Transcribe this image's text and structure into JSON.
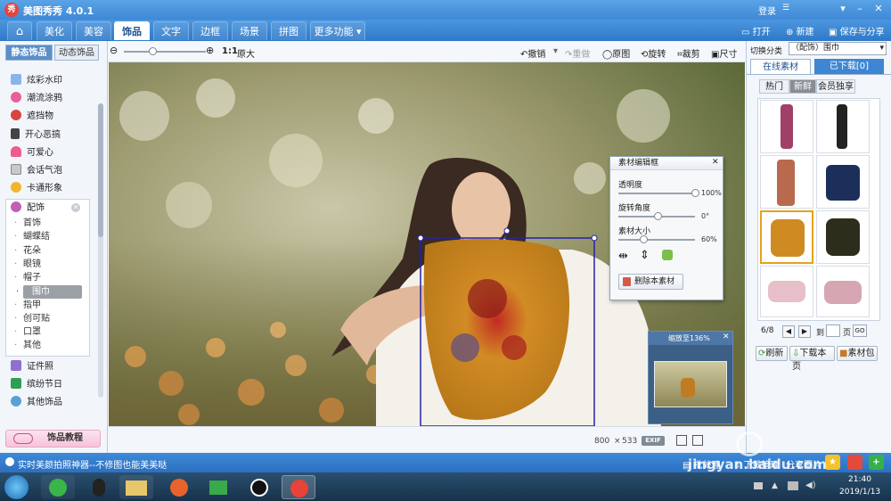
{
  "app": {
    "title": "美图秀秀 4.0.1",
    "logo_text": "秀",
    "login": "登录"
  },
  "nav": {
    "tabs": [
      "美化",
      "美容",
      "饰品",
      "文字",
      "边框",
      "场景",
      "拼图"
    ],
    "more": "更多功能",
    "open": "打开",
    "new": "新建",
    "save_share": "保存与分享"
  },
  "left": {
    "tab_static": "静态饰品",
    "tab_dynamic": "动态饰品",
    "categories": [
      "炫彩水印",
      "潮流涂鸦",
      "遮挡物",
      "开心恶搞",
      "可爱心",
      "会话气泡",
      "卡通形象"
    ],
    "expanded": {
      "label": "配饰",
      "subs": [
        "首饰",
        "蝴蝶结",
        "花朵",
        "眼镜",
        "帽子",
        "围巾",
        "指甲",
        "创可贴",
        "口罩",
        "其他"
      ],
      "selected": "围巾"
    },
    "categories_bottom": [
      "证件照",
      "缤纷节日",
      "其他饰品"
    ],
    "tutorial": "饰品教程"
  },
  "toolbar": {
    "zoom_ratio": "1:1",
    "original_size": "原大",
    "undo": "撤销",
    "redo": "重做",
    "original": "原图",
    "rotate": "旋转",
    "crop": "裁剪",
    "resize": "尺寸"
  },
  "right": {
    "category_label": "切换分类",
    "category_value": "（配饰）围巾",
    "tab_online": "在线素材",
    "tab_downloaded": "已下载[0]",
    "filters": [
      "热门",
      "新鲜",
      "会员独享"
    ],
    "active_filter": "新鲜",
    "page_current": "6/8",
    "goto_label": "到",
    "page_unit": "页",
    "go": "GO",
    "refresh": "刷新",
    "download_page": "下载本页",
    "material_pack": "素材包"
  },
  "dialog": {
    "title": "素材编辑框",
    "opacity_label": "透明度",
    "opacity_value": "100%",
    "opacity_level": 1.0,
    "rotate_label": "旋转角度",
    "rotate_value": "0°",
    "rotate_level": 0.5,
    "size_label": "素材大小",
    "size_value": "60%",
    "size_level": 0.3,
    "delete": "删除本素材"
  },
  "minimap": {
    "zoom_text": "缩放至136%"
  },
  "status": {
    "width": "800",
    "times": "×",
    "height": "533",
    "exif": "EXIF"
  },
  "bottom": {
    "tip": "实时美颜拍照神器--不修图也能美美哒",
    "batch": "批处理",
    "download_manage": "下载管理",
    "share_image": "分享图片"
  },
  "taskbar": {
    "time": "21:40",
    "date": "2019/1/13"
  },
  "watermark": "jingyan.baidu.com"
}
